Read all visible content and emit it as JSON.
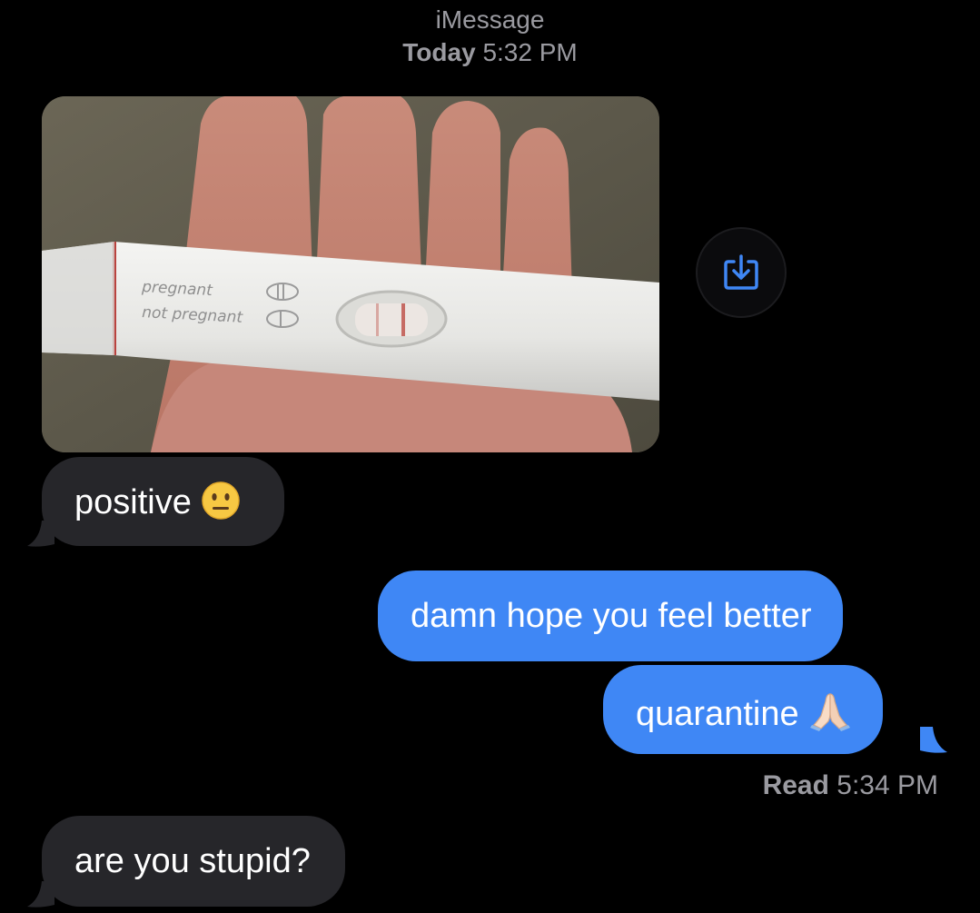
{
  "header": {
    "service": "iMessage",
    "day": "Today",
    "time": "5:32 PM"
  },
  "photo_attachment": {
    "test_labels": [
      "pregnant",
      "not pregnant"
    ]
  },
  "messages": [
    {
      "direction": "incoming",
      "text": "positive",
      "emoji": "neutral-face"
    },
    {
      "direction": "outgoing",
      "text": "damn hope you feel better"
    },
    {
      "direction": "outgoing",
      "text": "quarantine",
      "emoji": "folded-hands"
    },
    {
      "direction": "incoming",
      "text": "are you stupid?"
    }
  ],
  "receipt": {
    "status": "Read",
    "time": "5:34 PM"
  },
  "icons": {
    "save": "download-to-tray-icon"
  },
  "colors": {
    "background": "#000000",
    "incoming_bubble": "#26262a",
    "outgoing_bubble": "#3f87f5",
    "meta_text": "#9a9aa0",
    "icon_accent": "#3f87f5"
  }
}
